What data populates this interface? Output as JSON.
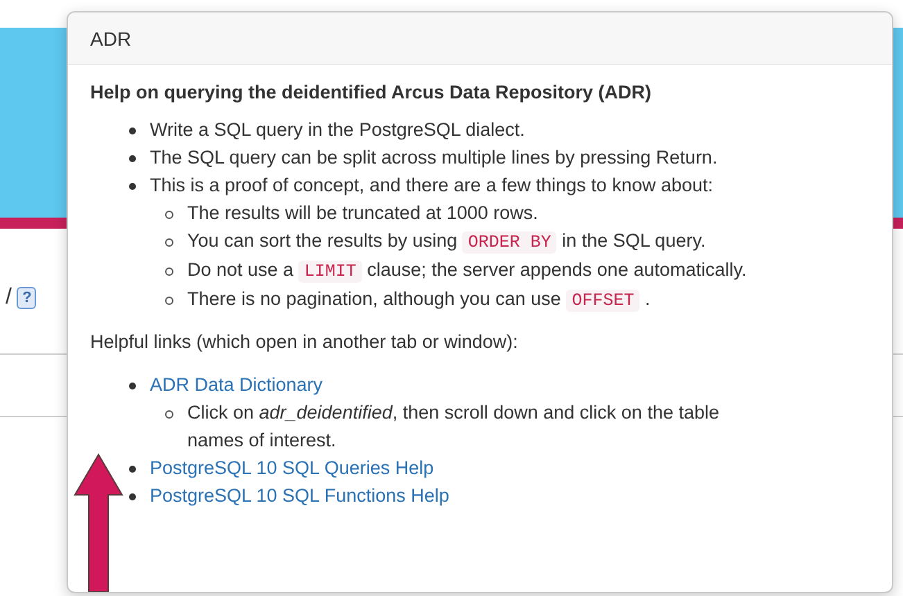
{
  "page": {
    "fragment": "/",
    "help_icon": "?"
  },
  "popover": {
    "title": "ADR",
    "heading": "Help on querying the deidentified Arcus Data Repository (ADR)",
    "items": [
      {
        "parts": [
          {
            "kind": "text",
            "text": "Write a SQL query in the PostgreSQL dialect."
          }
        ]
      },
      {
        "parts": [
          {
            "kind": "text",
            "text": "The SQL query can be split across multiple lines by pressing Return."
          }
        ]
      },
      {
        "parts": [
          {
            "kind": "text",
            "text": "This is a proof of concept, and there are a few things to know about:"
          }
        ],
        "children": [
          {
            "parts": [
              {
                "kind": "text",
                "text": "The results will be truncated at 1000 rows."
              }
            ]
          },
          {
            "parts": [
              {
                "kind": "text",
                "text": "You can sort the results by using "
              },
              {
                "kind": "code",
                "text": "ORDER BY"
              },
              {
                "kind": "text",
                "text": " in the SQL query."
              }
            ]
          },
          {
            "parts": [
              {
                "kind": "text",
                "text": "Do not use a "
              },
              {
                "kind": "code",
                "text": "LIMIT"
              },
              {
                "kind": "text",
                "text": " clause; the server appends one automatically."
              }
            ]
          },
          {
            "parts": [
              {
                "kind": "text",
                "text": "There is no pagination, although you can use "
              },
              {
                "kind": "code",
                "text": "OFFSET"
              },
              {
                "kind": "text",
                "text": " ."
              }
            ]
          }
        ]
      }
    ],
    "links_intro": "Helpful links (which open in another tab or window):",
    "links": [
      {
        "text": "ADR Data Dictionary",
        "children": [
          "Click on *adr_deidentified*, then scroll down and click on the table names of interest."
        ]
      },
      {
        "text": "PostgreSQL 10 SQL Queries Help"
      },
      {
        "text": "PostgreSQL 10 SQL Functions Help"
      }
    ]
  }
}
